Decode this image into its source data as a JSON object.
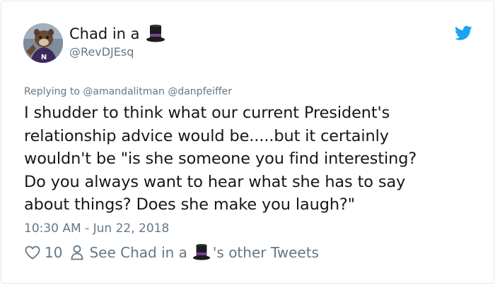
{
  "tweet": {
    "author": {
      "display_name": "Chad in a",
      "display_name_emoji": "top-hat-emoji",
      "handle": "@RevDJEsq",
      "avatar": "mascot-avatar"
    },
    "brand_icon": "twitter-bird-icon",
    "colors": {
      "brand_blue": "#1da1f2",
      "text": "#14171a",
      "muted": "#657786",
      "border": "#e1e8ed",
      "hat_purple": "#7b3fa0"
    },
    "replying": {
      "prefix": "Replying to",
      "mentions": [
        "@amandalitman",
        "@danpfeiffer"
      ]
    },
    "text": "I shudder to think what our current President's\nrelationship advice would be.....but it certainly\nwouldn't be \"is she someone you find interesting?\nDo you always want to hear what she has to say\nabout things? Does she make you laugh?\"",
    "timestamp": "10:30 AM - Jun 22, 2018",
    "actions": {
      "likes": "10",
      "see_prefix": "See Chad in a",
      "see_suffix": "'s other Tweets"
    }
  }
}
